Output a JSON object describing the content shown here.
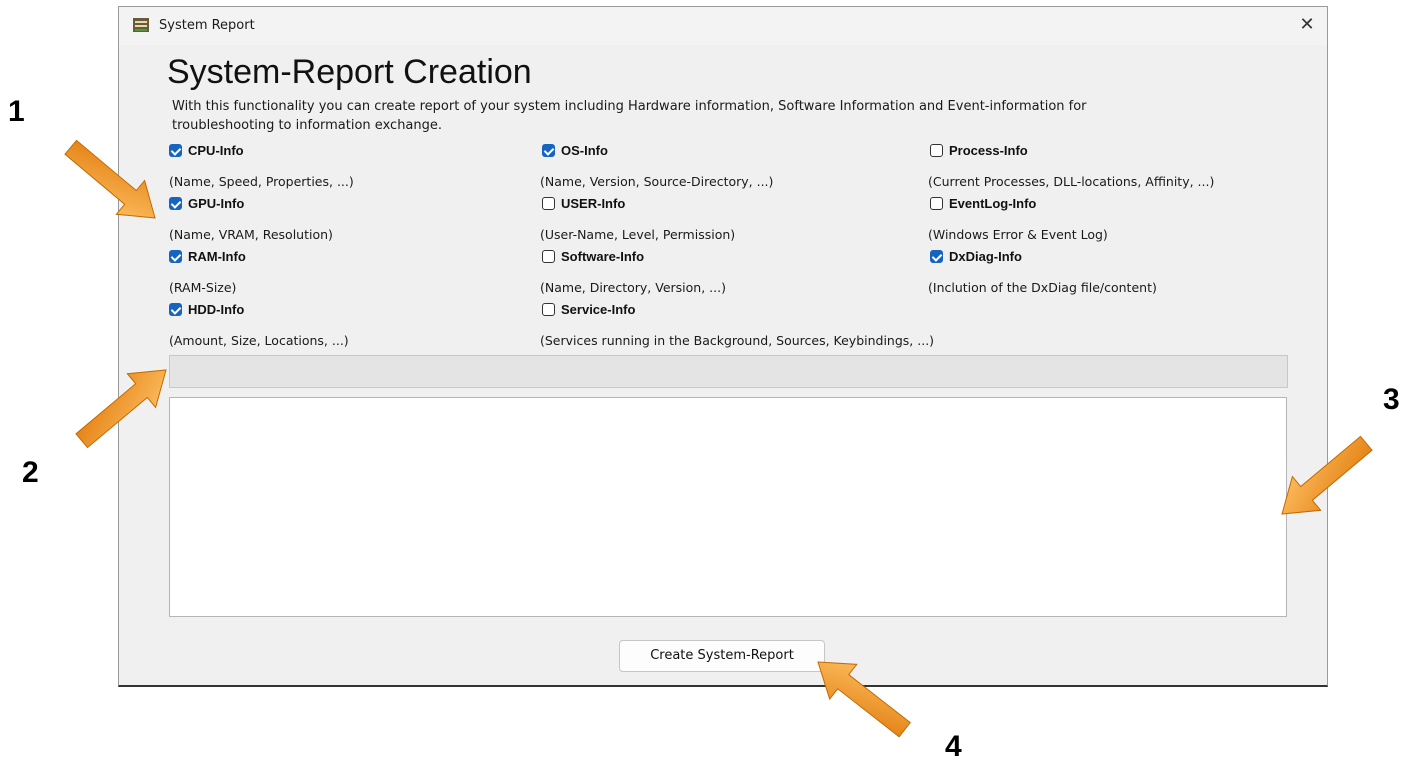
{
  "window": {
    "title": "System Report",
    "close_glyph": "✕"
  },
  "heading": "System-Report Creation",
  "description": "With this functionality you can create report of your system including Hardware information, Software Information and Event-information for troubleshooting to information exchange.",
  "options": [
    {
      "label": "CPU-Info",
      "desc": "(Name, Speed, Properties, ...)",
      "checked": true
    },
    {
      "label": "GPU-Info",
      "desc": "(Name, VRAM, Resolution)",
      "checked": true
    },
    {
      "label": "RAM-Info",
      "desc": "(RAM-Size)",
      "checked": true
    },
    {
      "label": "HDD-Info",
      "desc": "(Amount, Size, Locations, ...)",
      "checked": true
    },
    {
      "label": "OS-Info",
      "desc": "(Name, Version, Source-Directory, ...)",
      "checked": true
    },
    {
      "label": "USER-Info",
      "desc": "(User-Name, Level, Permission)",
      "checked": false
    },
    {
      "label": "Software-Info",
      "desc": "(Name, Directory, Version, ...)",
      "checked": false
    },
    {
      "label": "Service-Info",
      "desc": "(Services running in the Background, Sources, Keybindings, ...)",
      "checked": false
    },
    {
      "label": "Process-Info",
      "desc": "(Current Processes, DLL-locations, Affinity, ...)",
      "checked": false
    },
    {
      "label": "EventLog-Info",
      "desc": "(Windows Error & Event Log)",
      "checked": false
    },
    {
      "label": "DxDiag-Info",
      "desc": "(Inclution of the DxDiag file/content)",
      "checked": true
    }
  ],
  "status_text": "",
  "output_text": "",
  "create_button_label": "Create System-Report",
  "callouts": {
    "c1": "1",
    "c2": "2",
    "c3": "3",
    "c4": "4"
  },
  "colors": {
    "accent": "#1565c0",
    "arrow": "#f39a1e"
  }
}
